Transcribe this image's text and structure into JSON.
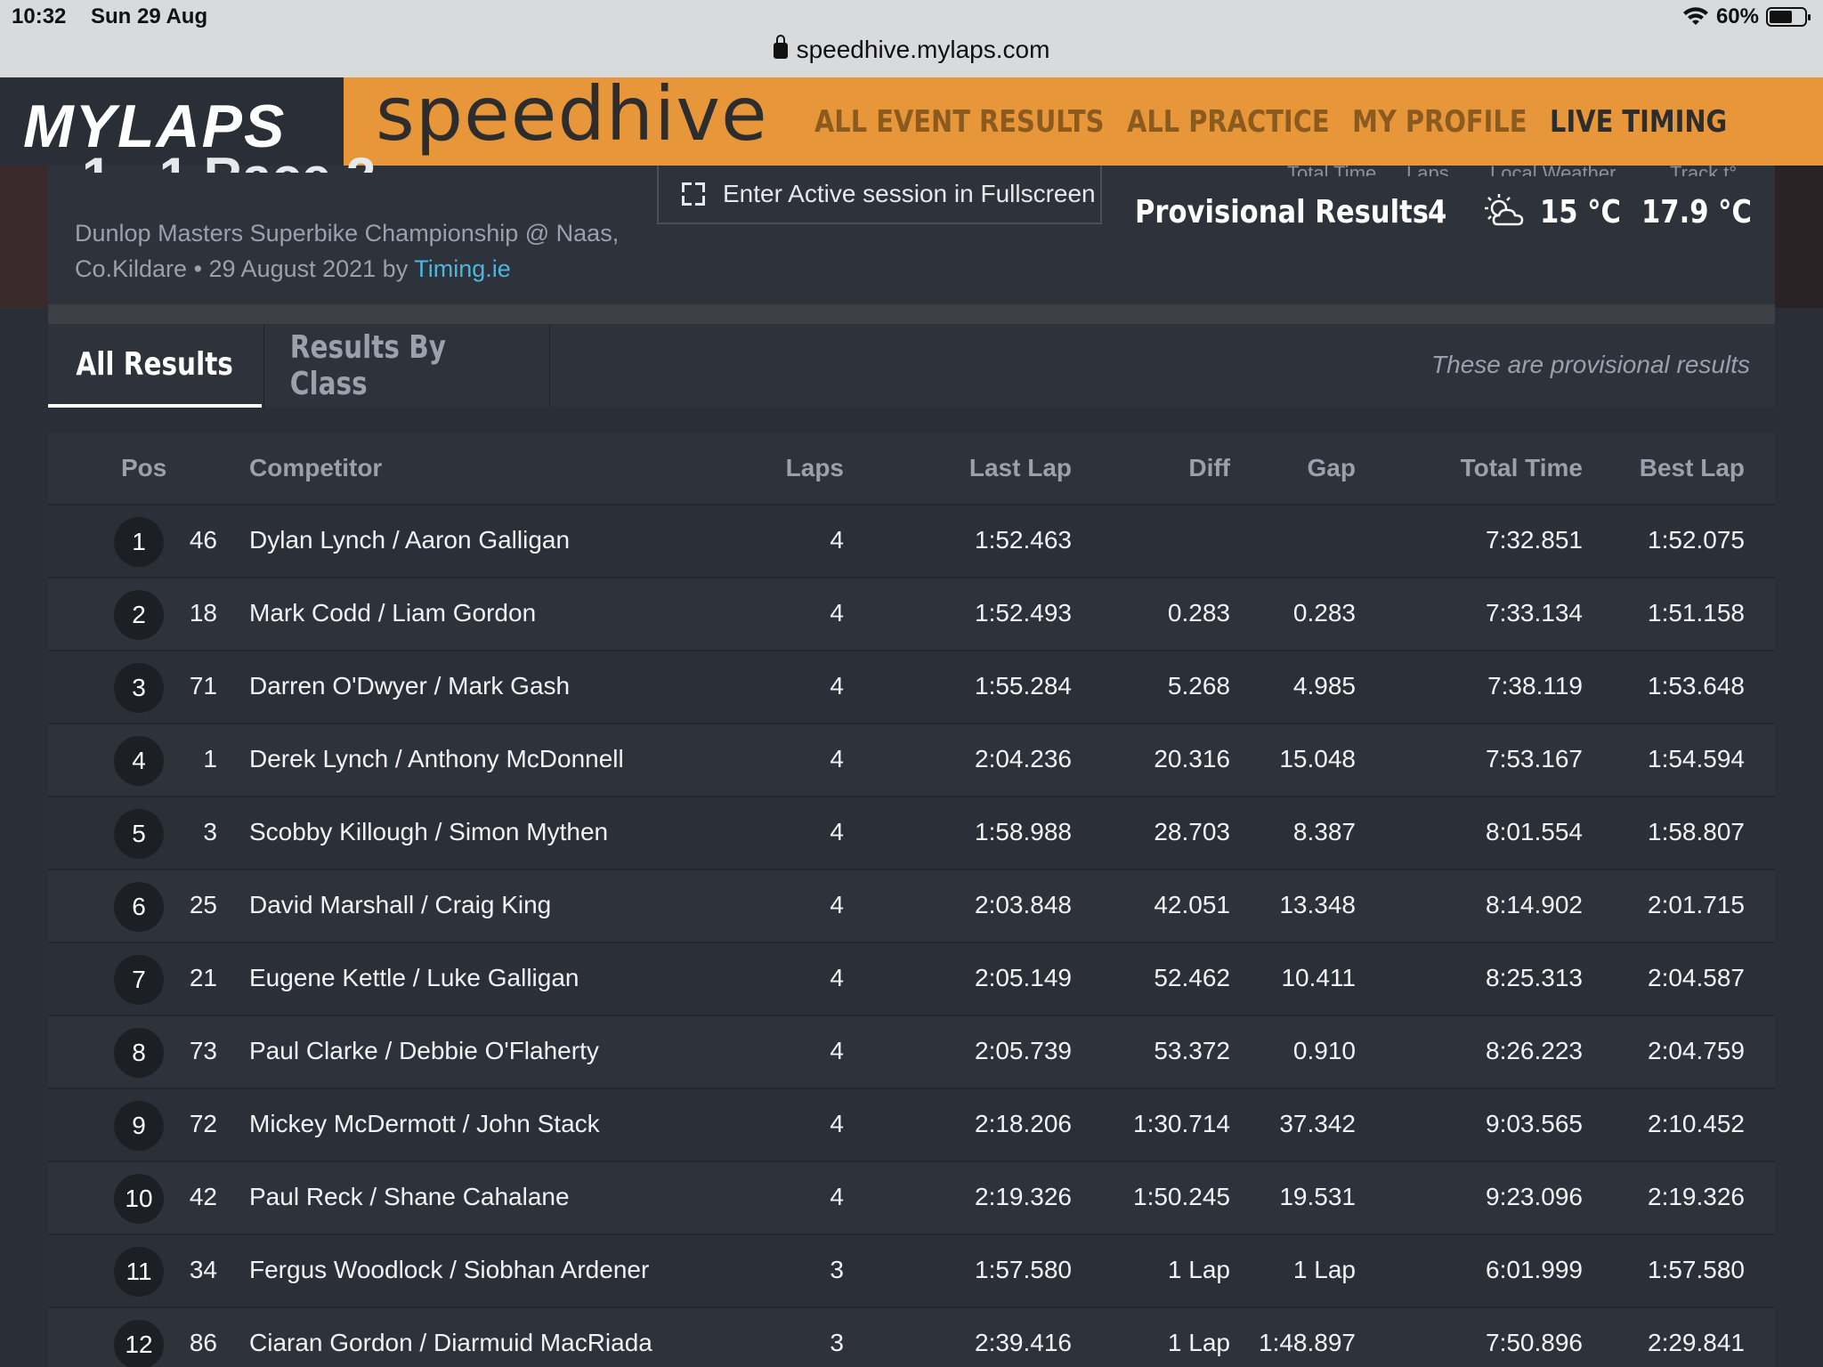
{
  "status_bar": {
    "time": "10:32",
    "date": "Sun 29 Aug",
    "battery": "60%"
  },
  "browser": {
    "url": "speedhive.mylaps.com"
  },
  "header": {
    "logo": "MYLAPS",
    "brand": "speedhive",
    "nav": [
      "ALL EVENT RESULTS",
      "ALL PRACTICE",
      "MY PROFILE",
      "LIVE TIMING"
    ],
    "active_nav": "LIVE TIMING"
  },
  "session": {
    "title": "1 - 1 Race 2",
    "event": "Dunlop Masters Superbike Championship @ Naas, Co.Kildare • 29 August 2021 by",
    "organizer": "Timing.ie",
    "fullscreen_label": "Enter Active session in Fullscreen",
    "stats": {
      "total_time_label": "Total Time",
      "total_time": "Provisional Results",
      "laps_label": "Laps",
      "laps": "4",
      "weather_label": "Local Weather",
      "weather": "15 °C",
      "track_label": "Track t°",
      "track": "17.9 °C"
    }
  },
  "tabs": {
    "all": "All Results",
    "by_class": "Results By Class",
    "note": "These are provisional results"
  },
  "table": {
    "headers": {
      "pos": "Pos",
      "competitor": "Competitor",
      "laps": "Laps",
      "last_lap": "Last Lap",
      "diff": "Diff",
      "gap": "Gap",
      "total_time": "Total Time",
      "best_lap": "Best Lap"
    },
    "rows": [
      {
        "pos": "1",
        "num": "46",
        "competitor": "Dylan Lynch / Aaron Galligan",
        "laps": "4",
        "last_lap": "1:52.463",
        "diff": "",
        "gap": "",
        "total": "7:32.851",
        "best": "1:52.075"
      },
      {
        "pos": "2",
        "num": "18",
        "competitor": "Mark Codd / Liam Gordon",
        "laps": "4",
        "last_lap": "1:52.493",
        "diff": "0.283",
        "gap": "0.283",
        "total": "7:33.134",
        "best": "1:51.158"
      },
      {
        "pos": "3",
        "num": "71",
        "competitor": "Darren O'Dwyer / Mark Gash",
        "laps": "4",
        "last_lap": "1:55.284",
        "diff": "5.268",
        "gap": "4.985",
        "total": "7:38.119",
        "best": "1:53.648"
      },
      {
        "pos": "4",
        "num": "1",
        "competitor": "Derek Lynch / Anthony McDonnell",
        "laps": "4",
        "last_lap": "2:04.236",
        "diff": "20.316",
        "gap": "15.048",
        "total": "7:53.167",
        "best": "1:54.594"
      },
      {
        "pos": "5",
        "num": "3",
        "competitor": "Scobby Killough / Simon Mythen",
        "laps": "4",
        "last_lap": "1:58.988",
        "diff": "28.703",
        "gap": "8.387",
        "total": "8:01.554",
        "best": "1:58.807"
      },
      {
        "pos": "6",
        "num": "25",
        "competitor": "David Marshall / Craig King",
        "laps": "4",
        "last_lap": "2:03.848",
        "diff": "42.051",
        "gap": "13.348",
        "total": "8:14.902",
        "best": "2:01.715"
      },
      {
        "pos": "7",
        "num": "21",
        "competitor": "Eugene Kettle / Luke Galligan",
        "laps": "4",
        "last_lap": "2:05.149",
        "diff": "52.462",
        "gap": "10.411",
        "total": "8:25.313",
        "best": "2:04.587"
      },
      {
        "pos": "8",
        "num": "73",
        "competitor": "Paul Clarke / Debbie O'Flaherty",
        "laps": "4",
        "last_lap": "2:05.739",
        "diff": "53.372",
        "gap": "0.910",
        "total": "8:26.223",
        "best": "2:04.759"
      },
      {
        "pos": "9",
        "num": "72",
        "competitor": "Mickey McDermott / John Stack",
        "laps": "4",
        "last_lap": "2:18.206",
        "diff": "1:30.714",
        "gap": "37.342",
        "total": "9:03.565",
        "best": "2:10.452"
      },
      {
        "pos": "10",
        "num": "42",
        "competitor": "Paul Reck / Shane Cahalane",
        "laps": "4",
        "last_lap": "2:19.326",
        "diff": "1:50.245",
        "gap": "19.531",
        "total": "9:23.096",
        "best": "2:19.326"
      },
      {
        "pos": "11",
        "num": "34",
        "competitor": "Fergus Woodlock / Siobhan Ardener",
        "laps": "3",
        "last_lap": "1:57.580",
        "diff": "1 Lap",
        "gap": "1 Lap",
        "total": "6:01.999",
        "best": "1:57.580"
      },
      {
        "pos": "12",
        "num": "86",
        "competitor": "Ciaran Gordon / Diarmuid MacRiada",
        "laps": "3",
        "last_lap": "2:39.416",
        "diff": "1 Lap",
        "gap": "1:48.897",
        "total": "7:50.896",
        "best": "2:29.841"
      }
    ]
  },
  "colors": {
    "accent": "#e8963a",
    "link": "#4fb5dd",
    "background": "#2a2e36"
  }
}
